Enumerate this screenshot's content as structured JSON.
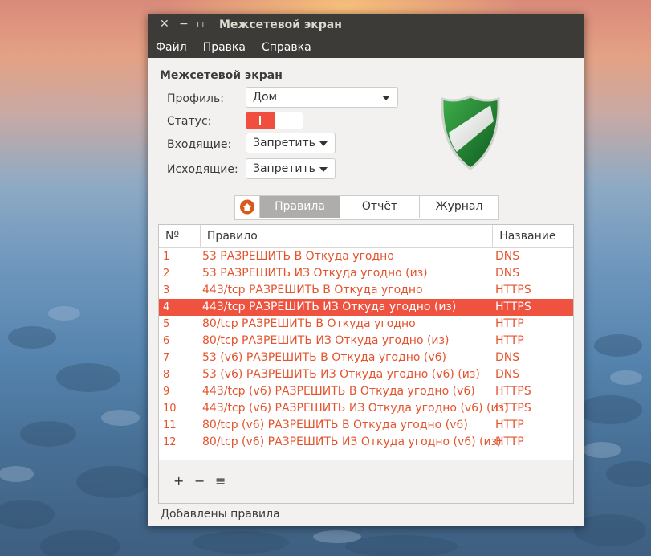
{
  "window": {
    "title": "Межсетевой экран",
    "controls": {
      "close": "✕",
      "minimize": "−",
      "maximize": "▫"
    }
  },
  "menu": [
    "Файл",
    "Правка",
    "Справка"
  ],
  "section_title": "Межсетевой экран",
  "profile": {
    "label": "Профиль:",
    "value": "Дом"
  },
  "status": {
    "label": "Статус:",
    "enabled": true
  },
  "incoming": {
    "label": "Входящие:",
    "value": "Запретить"
  },
  "outgoing": {
    "label": "Исходящие:",
    "value": "Запретить"
  },
  "tabs": {
    "home_icon": "home-icon",
    "rules": "Правила",
    "report": "Отчёт",
    "log": "Журнал",
    "active": "rules"
  },
  "table": {
    "headers": {
      "num": "Nº",
      "rule": "Правило",
      "name": "Название"
    },
    "selected_index": 3,
    "rows": [
      {
        "num": "1",
        "rule": "53 РАЗРЕШИТЬ В Откуда угодно",
        "name": "DNS"
      },
      {
        "num": "2",
        "rule": "53 РАЗРЕШИТЬ ИЗ Откуда угодно (из)",
        "name": "DNS"
      },
      {
        "num": "3",
        "rule": "443/tcp РАЗРЕШИТЬ В Откуда угодно",
        "name": "HTTPS"
      },
      {
        "num": "4",
        "rule": "443/tcp РАЗРЕШИТЬ ИЗ Откуда угодно (из)",
        "name": "HTTPS"
      },
      {
        "num": "5",
        "rule": "80/tcp РАЗРЕШИТЬ В Откуда угодно",
        "name": "HTTP"
      },
      {
        "num": "6",
        "rule": "80/tcp РАЗРЕШИТЬ ИЗ Откуда угодно (из)",
        "name": "HTTP"
      },
      {
        "num": "7",
        "rule": "53 (v6) РАЗРЕШИТЬ В Откуда угодно (v6)",
        "name": "DNS"
      },
      {
        "num": "8",
        "rule": "53 (v6) РАЗРЕШИТЬ ИЗ Откуда угодно (v6) (из)",
        "name": "DNS"
      },
      {
        "num": "9",
        "rule": "443/tcp (v6) РАЗРЕШИТЬ В Откуда угодно (v6)",
        "name": "HTTPS"
      },
      {
        "num": "10",
        "rule": "443/tcp (v6) РАЗРЕШИТЬ ИЗ Откуда угодно (v6) (из)",
        "name": "HTTPS"
      },
      {
        "num": "11",
        "rule": "80/tcp (v6) РАЗРЕШИТЬ В Откуда угодно (v6)",
        "name": "HTTP"
      },
      {
        "num": "12",
        "rule": "80/tcp (v6) РАЗРЕШИТЬ ИЗ Откуда угодно (v6) (из)",
        "name": "HTTP"
      }
    ]
  },
  "toolbar": {
    "add": "+",
    "remove": "−",
    "edit": "≡"
  },
  "statusbar": "Добавлены правила",
  "colors": {
    "accent": "#f05240",
    "rule_text": "#e4542e",
    "titlebar": "#3c3b37"
  }
}
